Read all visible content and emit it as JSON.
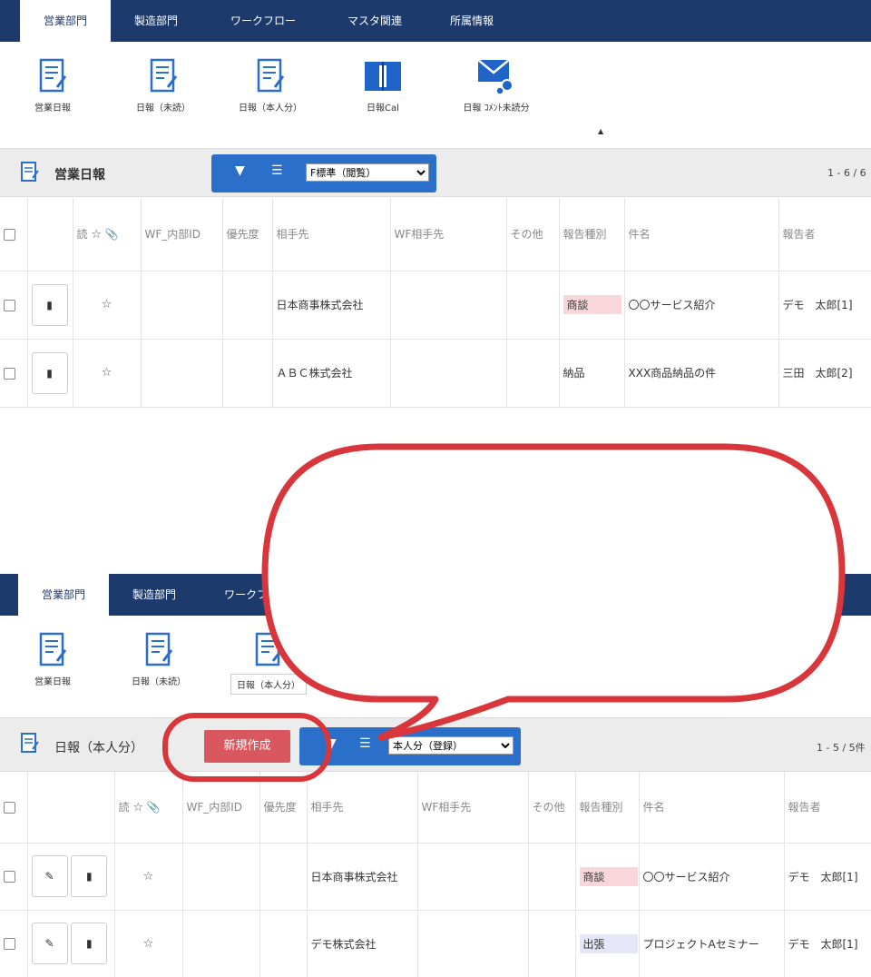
{
  "top": {
    "tabs": [
      "営業部門",
      "製造部門",
      "ワークフロー",
      "マスタ関連",
      "所属情報"
    ],
    "icons": [
      "営業日報",
      "日報（未読）",
      "日報（本人分）",
      "日報Cal",
      "日報 ｺﾒﾝﾄ未読分"
    ],
    "panel_title": "営業日報",
    "select_value": "F標準（閲覧）",
    "range": "1 - 6 / 6",
    "headers": [
      "読",
      "WF_内部ID",
      "優先度",
      "相手先",
      "WF相手先",
      "その他",
      "報告種別",
      "件名",
      "報告者"
    ],
    "rows": [
      {
        "partner": "日本商事株式会社",
        "type": "商談",
        "subject": "〇〇サービス紹介",
        "reporter": "デモ　太郎[1]"
      },
      {
        "partner": "ＡＢＣ株式会社",
        "type": "納品",
        "subject": "XXX商品納品の件",
        "reporter": "三田　太郎[2]"
      }
    ]
  },
  "bottom": {
    "tabs": [
      "営業部門",
      "製造部門",
      "ワークフ"
    ],
    "icons": [
      "営業日報",
      "日報（未読）",
      "日報（本人分）"
    ],
    "panel_title": "日報（本人分）",
    "new_button": "新規作成",
    "select_value": "本人分（登録）",
    "range": "1 - 5 / 5件",
    "headers": [
      "読",
      "WF_内部ID",
      "優先度",
      "相手先",
      "WF相手先",
      "その他",
      "報告種別",
      "件名",
      "報告者"
    ],
    "rows": [
      {
        "partner": "日本商事株式会社",
        "type": "商談",
        "subject": "〇〇サービス紹介",
        "reporter": "デモ　太郎[1]"
      },
      {
        "partner": "デモ株式会社",
        "type": "出張",
        "subject": "プロジェクトAセミナー",
        "reporter": "デモ　太郎[1]"
      }
    ]
  },
  "colors": {
    "nav": "#1c3a6b",
    "accent_blue": "#2a6fc9",
    "new_button": "#d9585f",
    "callout": "#d8363b"
  }
}
